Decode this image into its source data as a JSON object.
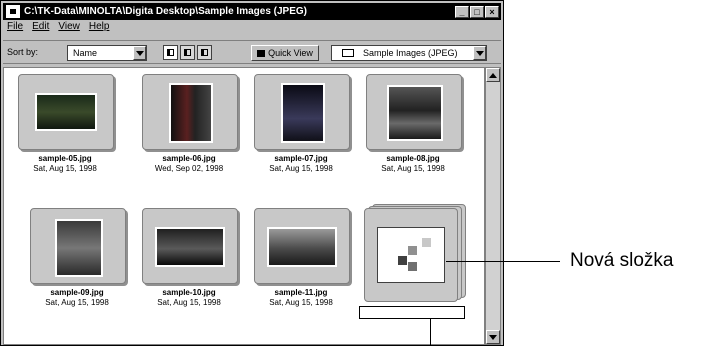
{
  "window": {
    "title": "C:\\TK-Data\\MINOLTA\\Digita Desktop\\Sample Images (JPEG)",
    "buttons": [
      "_",
      "□",
      "×"
    ]
  },
  "menu": [
    "File",
    "Edit",
    "View",
    "Help"
  ],
  "toolbar": {
    "sort_label": "Sort by:",
    "sort_value": "Name",
    "quick_view_label": "Quick View",
    "folder_value": "Sample Images (JPEG)"
  },
  "images": [
    {
      "file": "sample-05.jpg",
      "date": "Sat, Aug 15, 1998",
      "orientation": "landscape"
    },
    {
      "file": "sample-06.jpg",
      "date": "Wed, Sep 02, 1998",
      "orientation": "portrait"
    },
    {
      "file": "sample-07.jpg",
      "date": "Sat, Aug 15, 1998",
      "orientation": "portrait"
    },
    {
      "file": "sample-08.jpg",
      "date": "Sat, Aug 15, 1998",
      "orientation": "portrait"
    },
    {
      "file": "sample-09.jpg",
      "date": "Sat, Aug 15, 1998",
      "orientation": "portrait"
    },
    {
      "file": "sample-10.jpg",
      "date": "Sat, Aug 15, 1998",
      "orientation": "landscape"
    },
    {
      "file": "sample-11.jpg",
      "date": "Sat, Aug 15, 1998",
      "orientation": "landscape"
    }
  ],
  "new_folder": {
    "callout": "Nová složka",
    "name_value": ""
  },
  "colors": {
    "titlebar": "#000000",
    "window_chrome": "#c0c0c0",
    "tile": "#c8c8c8"
  }
}
